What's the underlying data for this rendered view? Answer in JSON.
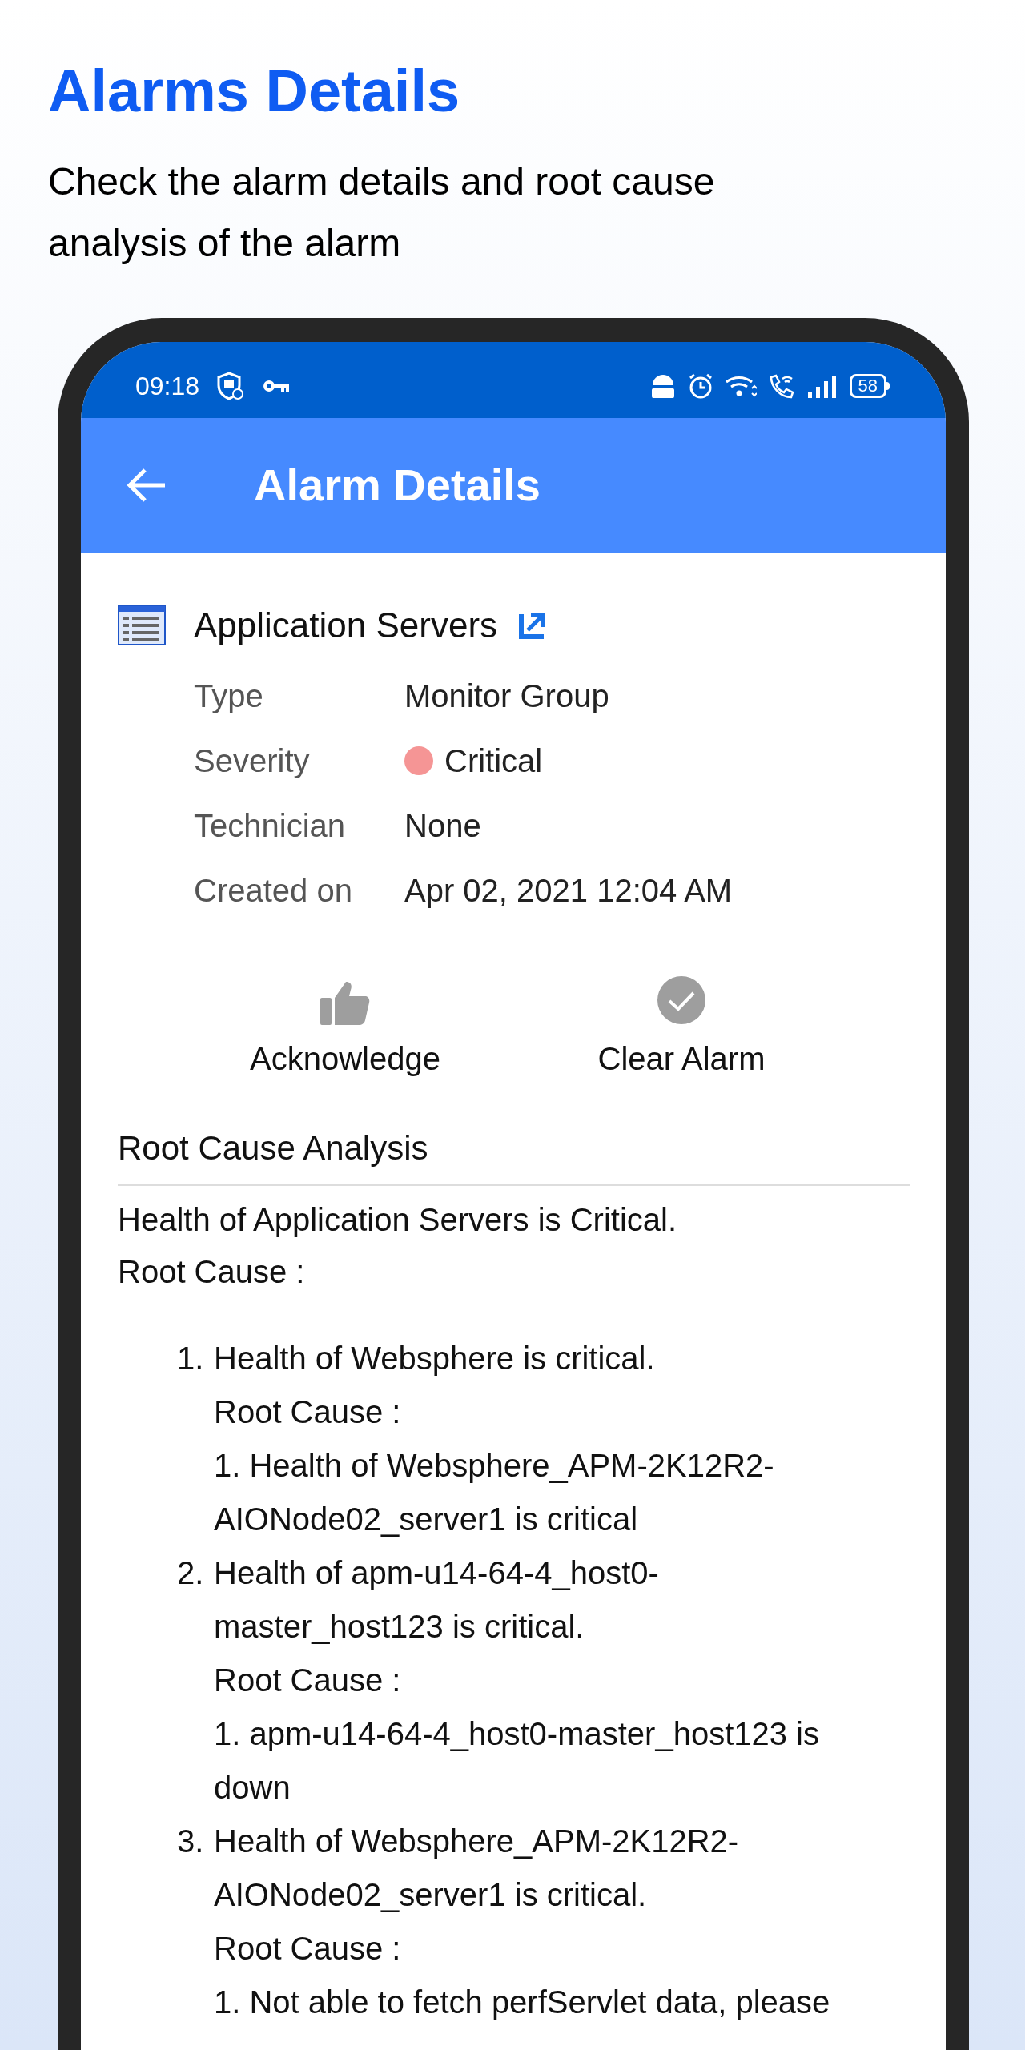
{
  "page_header": {
    "title": "Alarms Details",
    "subtitle": "Check the alarm details and root cause analysis of the alarm"
  },
  "status_bar": {
    "time": "09:18",
    "battery": "58"
  },
  "app_bar": {
    "title": "Alarm Details"
  },
  "alarm": {
    "name": "Application Servers",
    "details": [
      {
        "label": "Type",
        "value": "Monitor Group"
      },
      {
        "label": "Severity",
        "value": "Critical",
        "color": "#f59595"
      },
      {
        "label": "Technician",
        "value": "None"
      },
      {
        "label": "Created on",
        "value": "Apr 02, 2021 12:04 AM"
      }
    ]
  },
  "actions": [
    {
      "kind": "acknowledge",
      "label": "Acknowledge"
    },
    {
      "kind": "clear",
      "label": "Clear Alarm"
    }
  ],
  "root_cause_analysis": {
    "title": "Root Cause Analysis",
    "summary": [
      "Health of Application Servers is Critical.",
      "Root Cause :"
    ],
    "items": [
      {
        "number": "1.",
        "text": "Health of Websphere is critical.",
        "cause_label": "Root Cause :",
        "causes": [
          "1. Health of Websphere_APM-2K12R2-AIONode02_server1 is critical"
        ]
      },
      {
        "number": "2.",
        "text": "Health of apm-u14-64-4_host0-master_host123 is critical.",
        "cause_label": "Root Cause :",
        "causes": [
          "1. apm-u14-64-4_host0-master_host123 is down"
        ]
      },
      {
        "number": "3.",
        "text": "Health of Websphere_APM-2K12R2-AIONode02_server1 is critical.",
        "cause_label": "Root Cause :",
        "causes": [
          "1. Not able to fetch perfServlet data, please"
        ]
      }
    ]
  }
}
